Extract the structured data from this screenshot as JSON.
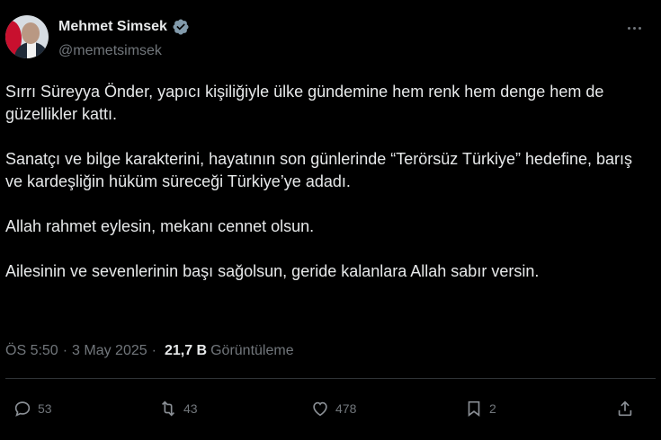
{
  "user": {
    "name": "Mehmet Simsek",
    "handle": "@memetsimsek",
    "verified_icon": "verified-badge-icon"
  },
  "tweet": {
    "paragraphs": [
      "Sırrı Süreyya Önder, yapıcı kişiliğiyle ülke gündemine hem renk hem denge hem de güzellikler kattı.",
      "Sanatçı ve bilge karakterini, hayatının son günlerinde “Terörsüz Türkiye” hedefine,  barış ve kardeşliğin hüküm süreceği Türkiye’ye adadı.",
      "Allah rahmet eylesin, mekanı cennet olsun.",
      "Ailesinin ve sevenlerinin başı sağolsun, geride kalanlara Allah sabır versin."
    ]
  },
  "meta": {
    "time": "ÖS 5:50",
    "date": "3 May 2025",
    "views": "21,7 B",
    "views_label": "Görüntüleme"
  },
  "actions": {
    "replies": "53",
    "reposts": "43",
    "likes": "478",
    "bookmarks": "2"
  },
  "colors": {
    "background": "#000000",
    "text": "#e7e9ea",
    "muted": "#71767b",
    "verified": "#829aab"
  }
}
